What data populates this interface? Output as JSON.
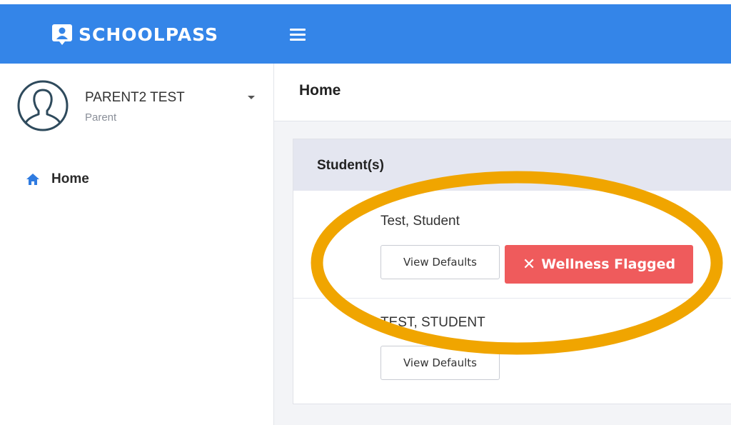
{
  "header": {
    "brand": "SCHOOLPASS",
    "brand_logo_icon": "id-badge-icon",
    "menu_icon": "hamburger-menu-icon"
  },
  "sidebar": {
    "user": {
      "name": "PARENT2 TEST",
      "role": "Parent",
      "avatar_icon": "user-silhouette-icon"
    },
    "nav": [
      {
        "label": "Home",
        "icon": "home-icon"
      }
    ]
  },
  "main": {
    "page_title": "Home",
    "card_title": "Student(s)",
    "students": [
      {
        "name": "Test, Student",
        "view_defaults": "View Defaults",
        "wellness": "Wellness Flagged"
      },
      {
        "name": "TEST, STUDENT",
        "view_defaults": "View Defaults"
      }
    ]
  },
  "colors": {
    "topbar": "#3485e8",
    "flag_button": "#ef5b5c",
    "highlight": "#f0a500",
    "card_header": "#e4e6f0"
  }
}
